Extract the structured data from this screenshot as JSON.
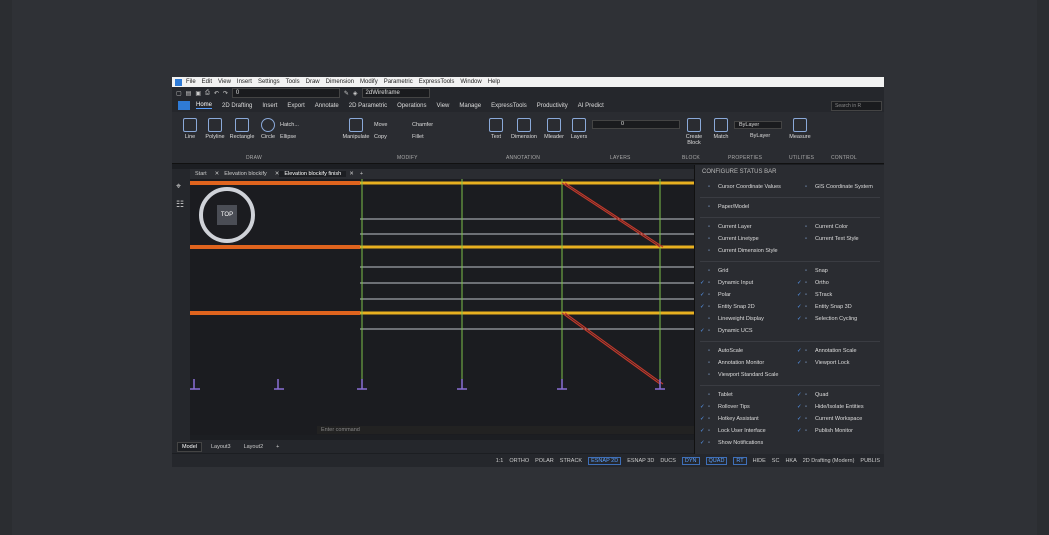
{
  "menubar": {
    "items": [
      "File",
      "Edit",
      "View",
      "Insert",
      "Settings",
      "Tools",
      "Draw",
      "Dimension",
      "Modify",
      "Parametric",
      "ExpressTools",
      "Window",
      "Help"
    ]
  },
  "qat": {
    "layer_value": "0",
    "visual_style": "2dWireframe"
  },
  "ribbon_tabs": [
    "Home",
    "2D Drafting",
    "Insert",
    "Export",
    "Annotate",
    "2D Parametric",
    "Operations",
    "View",
    "Manage",
    "ExpressTools",
    "Productivity",
    "AI Predict"
  ],
  "search_placeholder": "Search in R",
  "ribbon": {
    "draw": {
      "label": "DRAW",
      "tools": [
        "Line",
        "Polyline",
        "Rectangle",
        "Circle",
        "Hatch...",
        "Ellipse"
      ]
    },
    "modify": {
      "label": "MODIFY",
      "tools": [
        "Manipulate",
        "Move",
        "Copy",
        "Chamfer",
        "Fillet"
      ]
    },
    "annotation": {
      "label": "ANNOTATION",
      "tools": [
        "Text",
        "Dimension",
        "Mleader"
      ]
    },
    "layers": {
      "label": "LAYERS",
      "tools": [
        "Layers"
      ],
      "current": "0"
    },
    "block": {
      "label": "BLOCK",
      "tools": [
        "Create Block"
      ]
    },
    "properties": {
      "label": "PROPERTIES",
      "tools": [
        "Match"
      ],
      "color": "ByLayer",
      "linetype": "ByLayer"
    },
    "utilities": {
      "label": "UTILITIES",
      "tools": [
        "Measure"
      ]
    },
    "control": {
      "label": "CONTROL"
    }
  },
  "doc_tabs": [
    "Start",
    "Elevation blockify",
    "Elevation blockify finish"
  ],
  "viewcube_label": "TOP",
  "command_placeholder": "Enter command",
  "layout_tabs": [
    "Model",
    "Layout3",
    "Layout2"
  ],
  "status": {
    "scale": "1:1",
    "items": [
      "ORTHO",
      "POLAR",
      "STRACK",
      "ESNAP 2D",
      "ESNAP 3D",
      "DUCS",
      "DYN",
      "QUAD",
      "RT",
      "HIDE",
      "SC",
      "HKA",
      "2D Drafting (Modern)",
      "PUBLIS"
    ]
  },
  "popup": {
    "title": "CONFIGURE STATUS BAR",
    "groups": [
      [
        {
          "label": "Cursor Coordinate Values",
          "checked": false
        },
        {
          "label": "GIS Coordinate System",
          "checked": false
        }
      ],
      [
        {
          "label": "Paper/Model",
          "checked": false
        }
      ],
      [
        {
          "label": "Current Layer",
          "checked": false
        },
        {
          "label": "Current Color",
          "checked": false
        },
        {
          "label": "Current Linetype",
          "checked": false
        },
        {
          "label": "Current Text Style",
          "checked": false
        },
        {
          "label": "Current Dimension Style",
          "checked": false
        }
      ],
      [
        {
          "label": "Grid",
          "checked": false
        },
        {
          "label": "Snap",
          "checked": false
        },
        {
          "label": "Dynamic Input",
          "checked": true
        },
        {
          "label": "Ortho",
          "checked": true
        },
        {
          "label": "Polar",
          "checked": true
        },
        {
          "label": "STrack",
          "checked": true
        },
        {
          "label": "Entity Snap 2D",
          "checked": true
        },
        {
          "label": "Entity Snap 3D",
          "checked": true
        },
        {
          "label": "Lineweight Display",
          "checked": false
        },
        {
          "label": "Selection Cycling",
          "checked": true
        },
        {
          "label": "Dynamic UCS",
          "checked": true
        }
      ],
      [
        {
          "label": "AutoScale",
          "checked": false
        },
        {
          "label": "Annotation Scale",
          "checked": true
        },
        {
          "label": "Annotation Monitor",
          "checked": false
        },
        {
          "label": "Viewport Lock",
          "checked": true
        },
        {
          "label": "Viewport Standard Scale",
          "checked": false
        }
      ],
      [
        {
          "label": "Tablet",
          "checked": false
        },
        {
          "label": "Quad",
          "checked": true
        },
        {
          "label": "Rollover Tips",
          "checked": true
        },
        {
          "label": "Hide/Isolate Entities",
          "checked": true
        },
        {
          "label": "Hotkey Assistant",
          "checked": true
        },
        {
          "label": "Current Workspace",
          "checked": true
        },
        {
          "label": "Lock User Interface",
          "checked": true
        },
        {
          "label": "Publish Monitor",
          "checked": true
        },
        {
          "label": "Show Notifications",
          "checked": true
        }
      ]
    ]
  },
  "colors": {
    "accent": "#2f7bd6",
    "beam_orange": "#e0641e",
    "beam_yellow": "#e8b020",
    "column_green": "#7cc04a",
    "brace_red": "#c0392b",
    "support_purple": "#8a6fd6"
  }
}
